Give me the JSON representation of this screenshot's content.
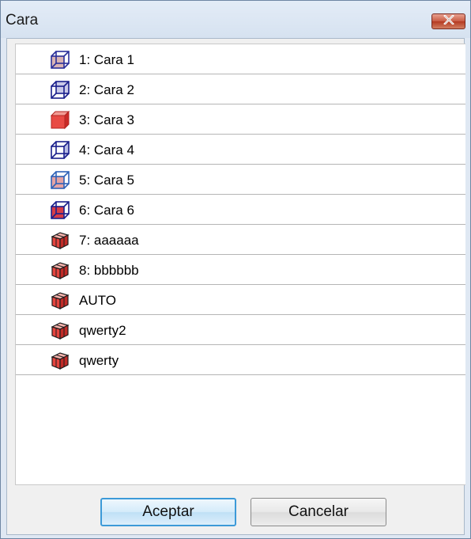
{
  "window": {
    "title": "Cara",
    "close_icon": "close-x-icon"
  },
  "colors": {
    "title_bar": "#dfe8f3",
    "close_button": "#c85a43",
    "wire_blue": "#1a1f8c",
    "solid_red": "#e23b36",
    "default_button_border": "#3c9ad8"
  },
  "list": {
    "items": [
      {
        "label": "1: Cara 1",
        "icon": "cube-face-1-icon"
      },
      {
        "label": "2: Cara 2",
        "icon": "cube-face-2-icon"
      },
      {
        "label": "3: Cara 3",
        "icon": "cube-face-3-icon"
      },
      {
        "label": "4: Cara 4",
        "icon": "cube-face-4-icon"
      },
      {
        "label": "5: Cara 5",
        "icon": "cube-face-5-icon"
      },
      {
        "label": "6: Cara 6",
        "icon": "cube-face-6-icon"
      },
      {
        "label": "7: aaaaaa",
        "icon": "cube-view-icon"
      },
      {
        "label": "8: bbbbbb",
        "icon": "cube-view-icon"
      },
      {
        "label": "AUTO",
        "icon": "cube-view-icon"
      },
      {
        "label": "qwerty2",
        "icon": "cube-view-icon"
      },
      {
        "label": "qwerty",
        "icon": "cube-view-icon"
      }
    ]
  },
  "buttons": {
    "ok_label": "Aceptar",
    "cancel_label": "Cancelar"
  }
}
